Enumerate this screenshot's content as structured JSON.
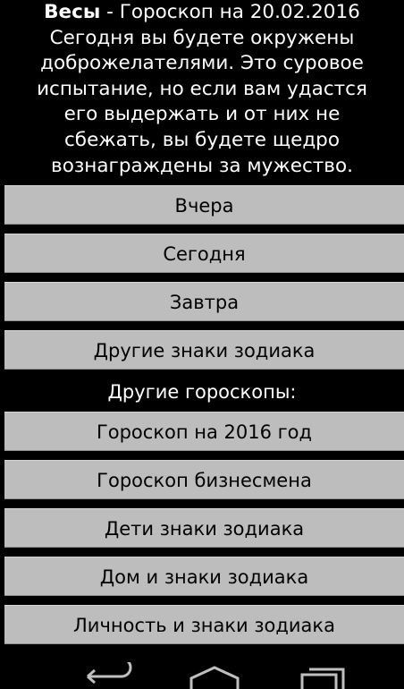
{
  "horoscope": {
    "sign": "Весы",
    "title_rest": " - Гороскоп на 20.02.2016",
    "text": "Сегодня вы будете окружены доброжелателями. Это суровое испытание, но если вам удастся его выдержать и от них не сбежать, вы будете щедро вознаграждены за мужество."
  },
  "day_buttons": {
    "yesterday": "Вчера",
    "today": "Сегодня",
    "tomorrow": "Завтра",
    "other_signs": "Другие знаки зодиака"
  },
  "other_section": {
    "label": "Другие гороскопы:",
    "year": "Гороскоп на 2016 год",
    "business": "Гороскоп бизнесмена",
    "children": "Дети знаки зодиака",
    "home": "Дом и знаки зодиака",
    "personality": "Личность и знаки зодиака"
  },
  "navbar": {
    "icons": [
      "back-icon",
      "home-icon",
      "recents-icon"
    ]
  },
  "colors": {
    "background": "#000000",
    "button_bg": "#bdbdbd",
    "button_text": "#000000",
    "text": "#ffffff"
  }
}
